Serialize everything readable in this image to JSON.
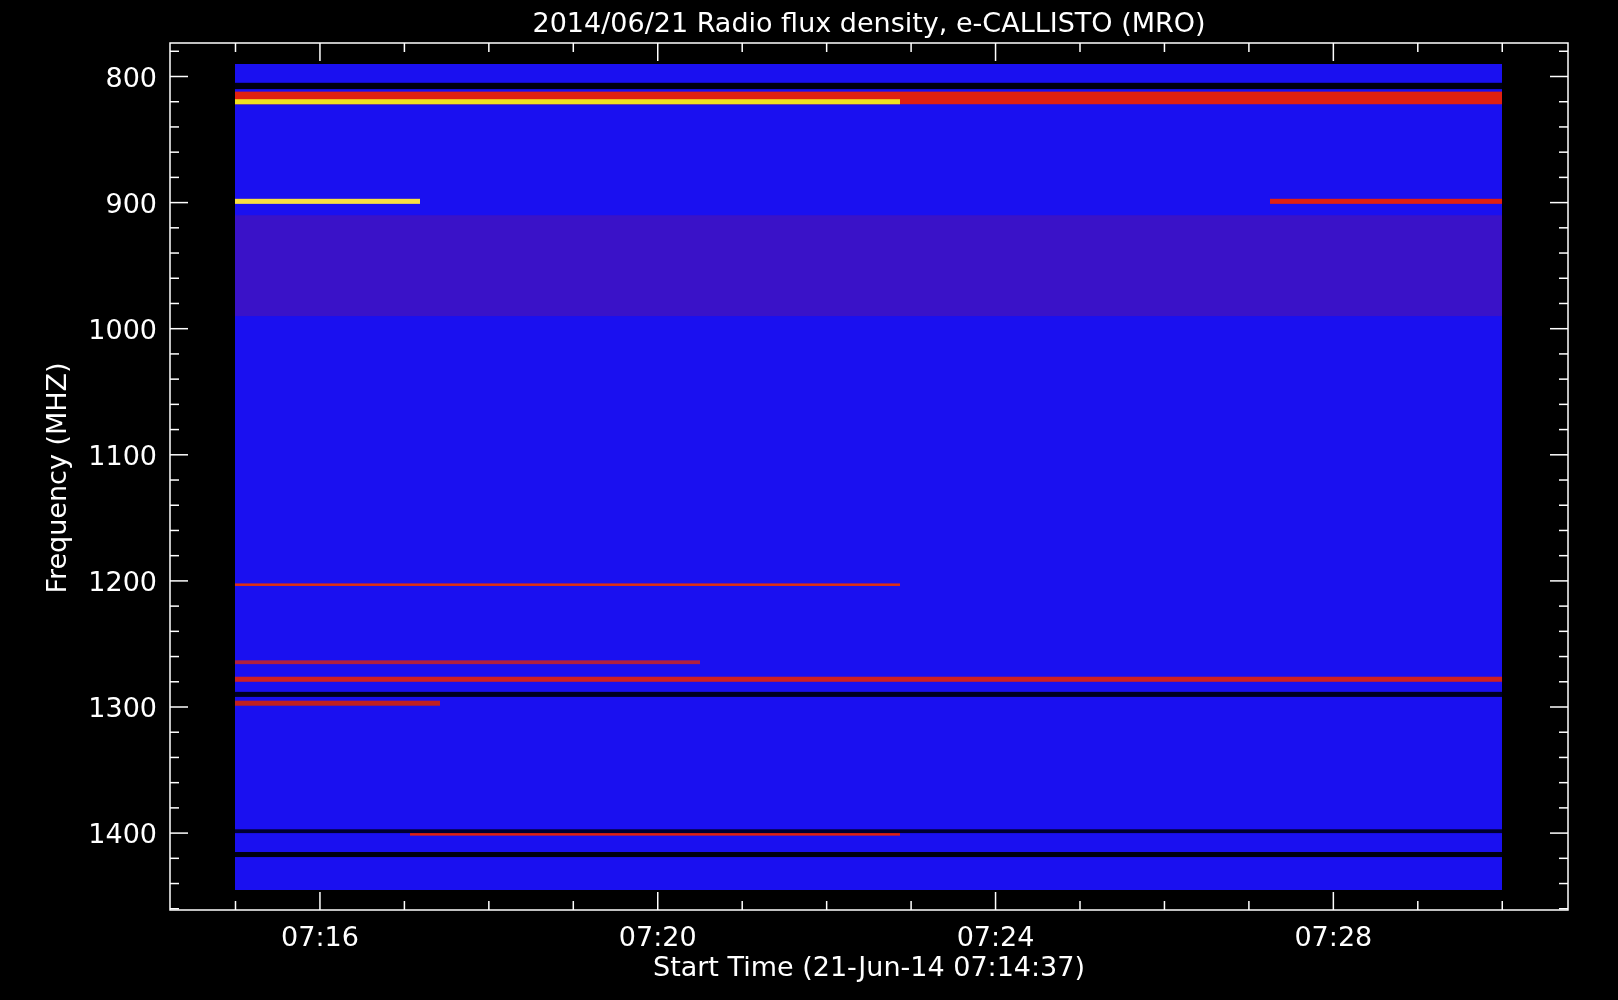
{
  "title": "2014/06/21  Radio flux density, e-CALLISTO (MRO)",
  "y_axis": {
    "label": "Frequency (MHZ)",
    "ticks": [
      "800",
      "900",
      "1000",
      "1100",
      "1200",
      "1300",
      "1400"
    ]
  },
  "x_axis": {
    "label": "Start Time (21-Jun-14 07:14:37)",
    "ticks": [
      "07:16",
      "07:20",
      "07:24",
      "07:28"
    ]
  }
}
